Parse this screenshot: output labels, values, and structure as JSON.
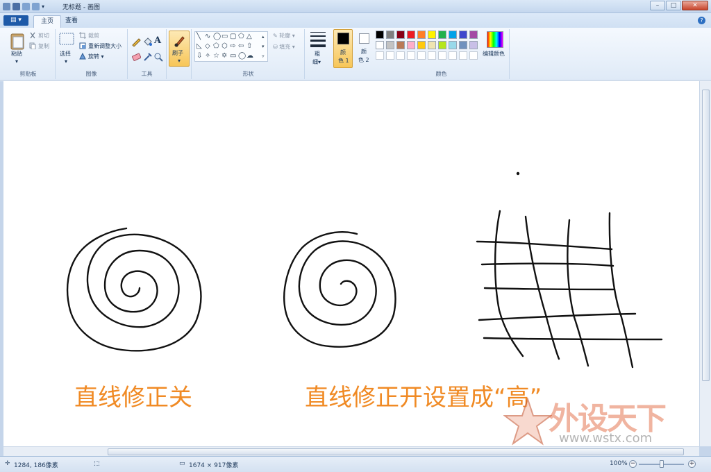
{
  "window": {
    "title": "无标题 - 画图"
  },
  "tabs": [
    {
      "label": "主页"
    },
    {
      "label": "查看"
    }
  ],
  "app_menu": {
    "label": "▾"
  },
  "ribbon": {
    "clipboard": {
      "paste": "粘贴",
      "cut": "剪切",
      "copy": "复制",
      "group": "剪贴板"
    },
    "image": {
      "select": "选择",
      "crop": "裁剪",
      "resize": "重新调整大小",
      "rotate": "旋转",
      "group": "图像"
    },
    "tools": {
      "group": "工具"
    },
    "brushes": {
      "label": "刷子"
    },
    "shapes": {
      "outline": "轮廓",
      "fill": "填充",
      "group": "形状"
    },
    "size": {
      "label1": "粗",
      "label2": "细"
    },
    "color1": {
      "label1": "颜",
      "label2": "色 1",
      "value": "#000000"
    },
    "color2": {
      "label1": "颜",
      "label2": "色 2",
      "value": "#ffffff"
    },
    "colors": {
      "group": "颜色",
      "edit": "编辑颜色",
      "palette_row1": [
        "#000000",
        "#7f7f7f",
        "#880015",
        "#ed1c24",
        "#ff7f27",
        "#fff200",
        "#22b14c",
        "#00a2e8",
        "#3f48cc",
        "#a349a4"
      ],
      "palette_row2": [
        "#ffffff",
        "#c3c3c3",
        "#b97a57",
        "#ffaec9",
        "#ffc90e",
        "#efe4b0",
        "#b5e61d",
        "#99d9ea",
        "#7092be",
        "#c8bfe7"
      ]
    }
  },
  "canvas": {
    "caption_left": "直线修正关",
    "caption_right": "直线修正开设置成“高”",
    "accent": "#f08a24"
  },
  "watermark": {
    "text": "外设天下",
    "url": "www.wstx.com"
  },
  "status": {
    "cursor_pos": "1284, 186像素",
    "image_size": "1674 × 917像素",
    "zoom": "100%"
  }
}
